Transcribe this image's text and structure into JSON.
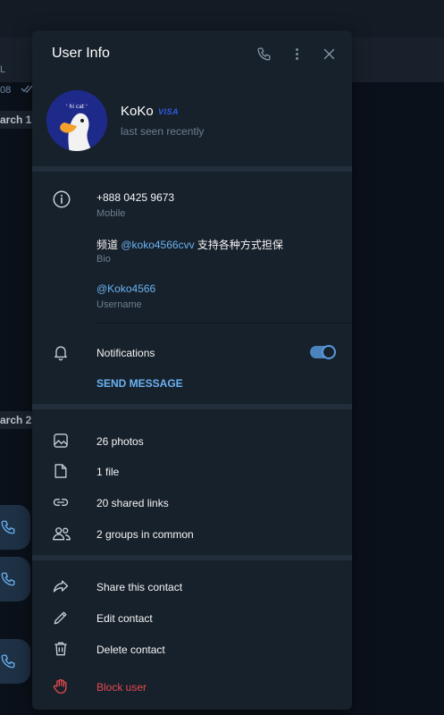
{
  "background": {
    "sender_fragment": "L",
    "time_fragment": "08",
    "date_1": "arch 1",
    "date_2": "arch 2"
  },
  "modal": {
    "title": "User Info",
    "icons": [
      "phone-icon",
      "more-vertical-icon",
      "close-icon"
    ]
  },
  "profile": {
    "name": "KoKo",
    "badge": "VISA",
    "status": "last seen recently"
  },
  "info": {
    "phone": "+888 0425 9673",
    "phone_label": "Mobile",
    "bio_prefix": "频道 ",
    "bio_link": "@koko4566cvv",
    "bio_suffix": " 支持各种方式担保",
    "bio_label": "Bio",
    "username": "@Koko4566",
    "username_label": "Username"
  },
  "notifications": {
    "label": "Notifications",
    "enabled": true,
    "send_message": "SEND MESSAGE"
  },
  "media": {
    "photos": "26 photos",
    "files": "1 file",
    "links": "20 shared links",
    "groups": "2 groups in common"
  },
  "actions": {
    "share": "Share this contact",
    "edit": "Edit contact",
    "delete": "Delete contact",
    "block": "Block user"
  },
  "colors": {
    "accent": "#6ab2f2",
    "danger": "#e5484d",
    "panel": "#17212b",
    "visa": "#2f5bea"
  }
}
